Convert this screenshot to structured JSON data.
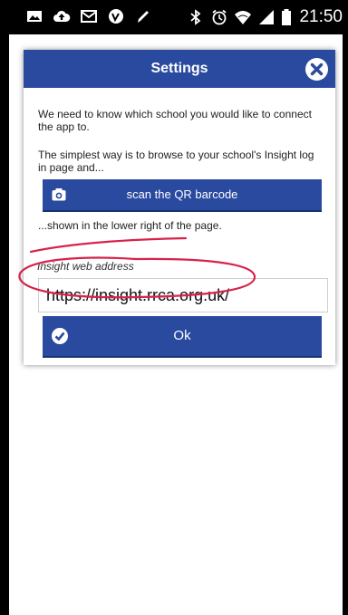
{
  "status_bar": {
    "time": "21:50",
    "left_icons": [
      "image-icon",
      "cloud-upload-icon",
      "mail-icon",
      "vine-icon",
      "pen-icon"
    ],
    "right_icons": [
      "bluetooth-icon",
      "alarm-icon",
      "wifi-icon",
      "signal-icon",
      "battery-icon"
    ]
  },
  "dialog": {
    "title": "Settings",
    "intro_text": "We need to know which school you would like to connect the app to.",
    "instruction_text": "The simplest way is to browse to your school's Insight log in page and...",
    "scan_button_label": "scan the QR barcode",
    "shown_text": "...shown in the lower right of the page.",
    "field_label": "Insight web address",
    "url_value": "https://insight.rrca.org.uk/",
    "ok_button_label": "Ok"
  },
  "colors": {
    "header_blue": "#2a4aa0",
    "annotation_red": "#d8234a"
  }
}
